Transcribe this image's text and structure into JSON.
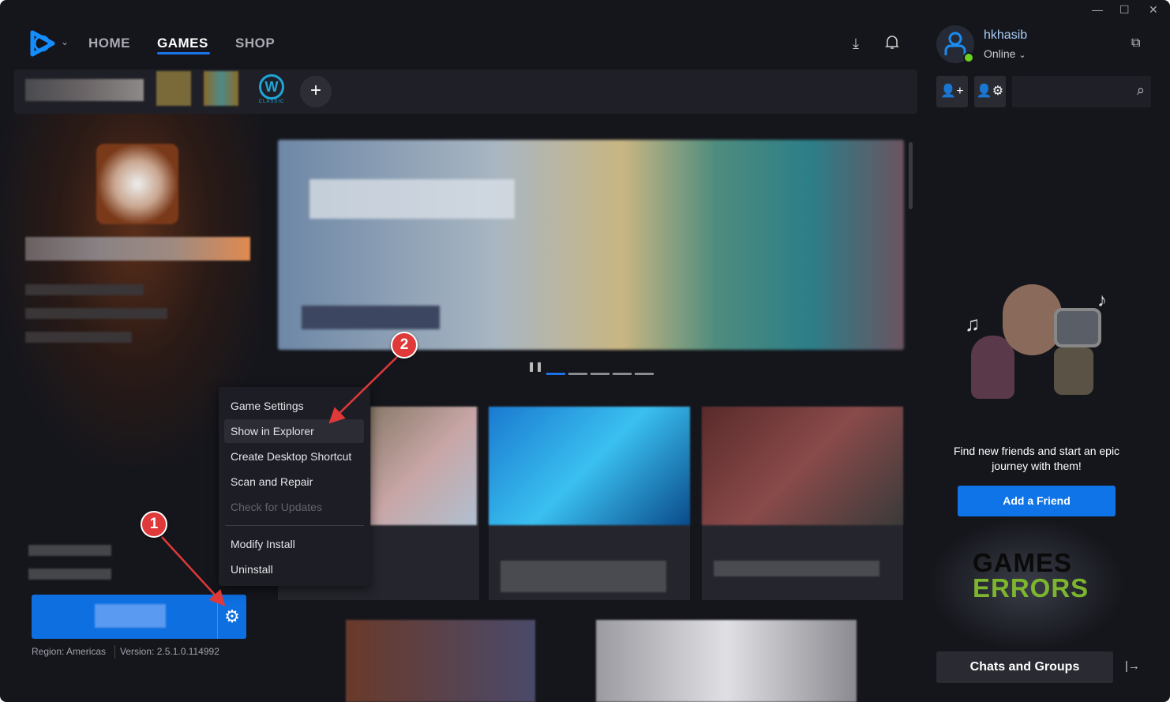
{
  "window": {
    "controls": {
      "minimize": "—",
      "maximize": "☐",
      "close": "✕"
    }
  },
  "nav": {
    "home": "HOME",
    "games": "GAMES",
    "shop": "SHOP",
    "active": "GAMES"
  },
  "gamebar": {
    "wow_classic_label": "CLASSIC",
    "wow_letter": "W",
    "add": "+"
  },
  "user": {
    "name": "hkhasib",
    "status": "Online",
    "status_color": "#6bd11f"
  },
  "context_menu": {
    "items": [
      {
        "label": "Game Settings",
        "enabled": true
      },
      {
        "label": "Show in Explorer",
        "enabled": true,
        "hovered": true
      },
      {
        "label": "Create Desktop Shortcut",
        "enabled": true
      },
      {
        "label": "Scan and Repair",
        "enabled": true
      },
      {
        "label": "Check for Updates",
        "enabled": false
      },
      {
        "label": "Modify Install",
        "enabled": true
      },
      {
        "label": "Uninstall",
        "enabled": true
      }
    ]
  },
  "footer": {
    "region": "Region: Americas",
    "version": "Version: 2.5.1.0.114992"
  },
  "annotations": {
    "step1": "1",
    "step2": "2"
  },
  "friends": {
    "message": "Find new friends and start an epic journey with them!",
    "add_friend": "Add a Friend",
    "chats": "Chats and Groups"
  },
  "watermark": {
    "line1": "GAMES",
    "line2": "ERRORS"
  },
  "carousel": {
    "slides": 5,
    "active": 1
  },
  "colors": {
    "accent": "#1a73e8",
    "background": "#15161c",
    "annotation": "#e0393a"
  }
}
